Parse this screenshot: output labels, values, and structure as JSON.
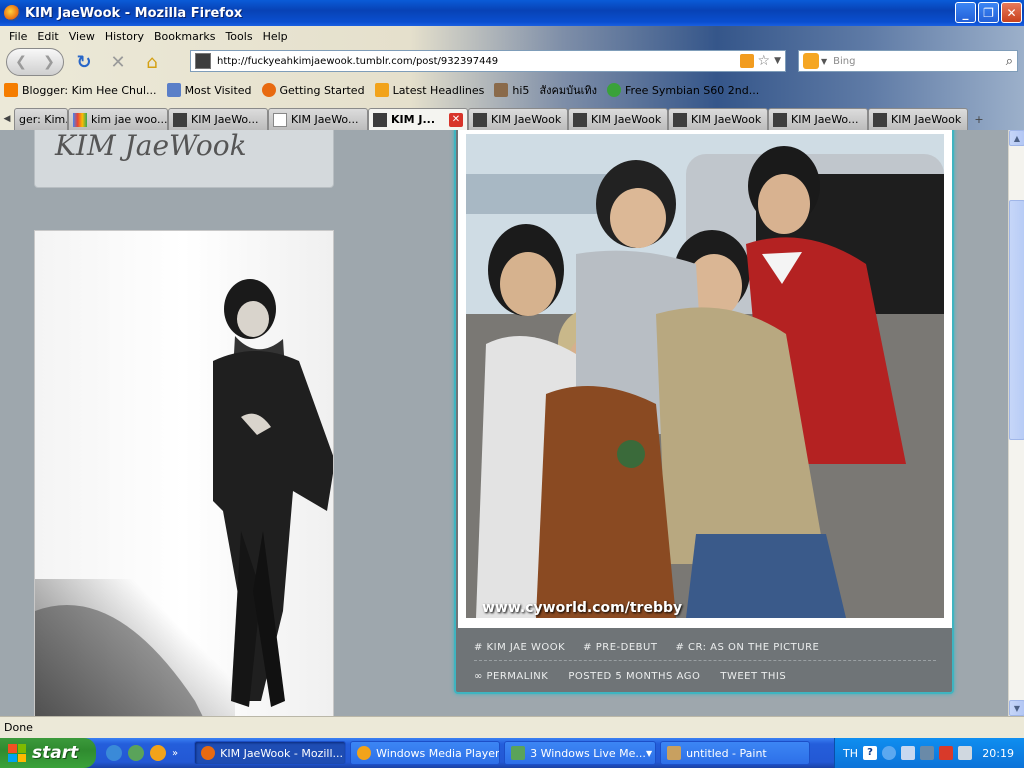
{
  "window": {
    "title": "KIM JaeWook - Mozilla Firefox"
  },
  "menu": [
    "File",
    "Edit",
    "View",
    "History",
    "Bookmarks",
    "Tools",
    "Help"
  ],
  "address": {
    "url": "http://fuckyeahkimjaewook.tumblr.com/post/932397449"
  },
  "search": {
    "placeholder": "Bing"
  },
  "bookmarks": [
    {
      "label": "Blogger: Kim Hee Chul...",
      "color": "#f57d00"
    },
    {
      "label": "Most Visited",
      "color": "#5a7fc8"
    },
    {
      "label": "Getting Started",
      "color": "#e86a10"
    },
    {
      "label": "Latest Headlines",
      "color": "#f2a31a"
    },
    {
      "label": "hi5",
      "color": "#8a6a4a"
    },
    {
      "label": "สังคมบันเทิง",
      "color": "#c84a4a"
    },
    {
      "label": "Free Symbian S60 2nd...",
      "color": "#3aa23a"
    }
  ],
  "tabs": [
    {
      "label": "ger: Kim...",
      "active": false
    },
    {
      "label": "kim jae woo...",
      "active": false
    },
    {
      "label": "KIM JaeWo...",
      "active": false
    },
    {
      "label": "KIM JaeWo...",
      "active": false
    },
    {
      "label": "KIM J...",
      "active": true
    },
    {
      "label": "KIM JaeWook",
      "active": false
    },
    {
      "label": "KIM JaeWook",
      "active": false
    },
    {
      "label": "KIM JaeWook",
      "active": false
    },
    {
      "label": "KIM JaeWo...",
      "active": false
    },
    {
      "label": "KIM JaeWook",
      "active": false
    }
  ],
  "blog": {
    "title": "KIM JaeWook",
    "watermark": "www.cyworld.com/trebby",
    "tags": [
      "# KIM JAE WOOK",
      "# PRE-DEBUT",
      "# CR: AS ON THE PICTURE"
    ],
    "permalink": "∞ PERMALINK",
    "posted": "POSTED 5 MONTHS AGO",
    "tweet": "TWEET THIS"
  },
  "status": {
    "text": "Done"
  },
  "taskbar": {
    "start": "start",
    "tasks": [
      {
        "label": "KIM JaeWook - Mozill...",
        "active": true,
        "color": "#e86a10"
      },
      {
        "label": "Windows Media Player",
        "active": false,
        "color": "#f2a31a"
      },
      {
        "label": "3 Windows Live Me...",
        "active": false,
        "color": "#5aa35a"
      },
      {
        "label": "untitled - Paint",
        "active": false,
        "color": "#c8a060"
      }
    ],
    "lang": "TH",
    "clock": "20:19"
  }
}
